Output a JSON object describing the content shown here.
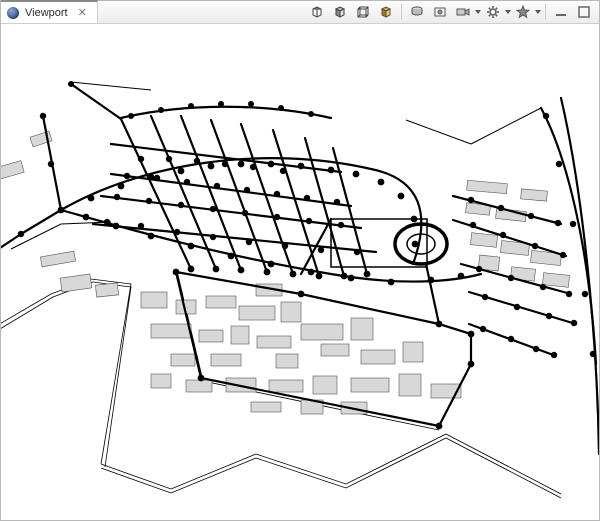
{
  "tab": {
    "title": "Viewport"
  },
  "toolbar": {
    "group_render": [
      "toggle-wireframe",
      "toggle-shaded",
      "toggle-bbox",
      "toggle-textured"
    ],
    "group_scene": [
      "scene-presets",
      "camera-reset",
      "camera-menu",
      "settings-menu",
      "favorites-menu"
    ],
    "group_panel": [
      "minimize-view",
      "maximize-view"
    ]
  }
}
